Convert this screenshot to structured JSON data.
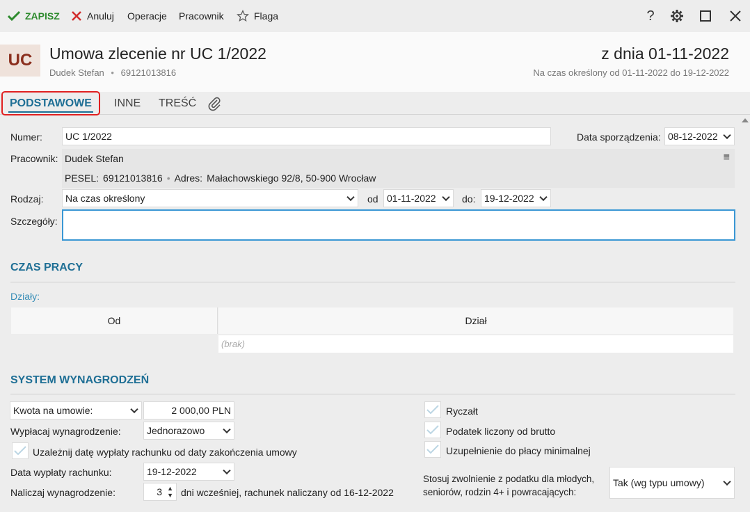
{
  "toolbar": {
    "save_label": "ZAPISZ",
    "cancel_label": "Anuluj",
    "operations_label": "Operacje",
    "employee_label": "Pracownik",
    "flag_label": "Flaga",
    "help_label": "?"
  },
  "header": {
    "badge": "UC",
    "title": "Umowa zlecenie nr UC 1/2022",
    "employee_name": "Dudek Stefan",
    "employee_id": "69121013816",
    "date_label": "z dnia 01-11-2022",
    "period_label": "Na czas określony od 01-11-2022 do 19-12-2022"
  },
  "tabs": [
    {
      "label": "PODSTAWOWE",
      "active": true
    },
    {
      "label": "INNE",
      "active": false
    },
    {
      "label": "TREŚĆ",
      "active": false
    }
  ],
  "form": {
    "number_label": "Numer:",
    "number_value": "UC 1/2022",
    "created_label": "Data sporządzenia:",
    "created_value": "08-12-2022",
    "employee_label": "Pracownik:",
    "employee_value": "Dudek Stefan",
    "pesel_label": "PESEL:",
    "pesel_value": "69121013816",
    "address_label": "Adres:",
    "address_value": "Małachowskiego 92/8, 50-900 Wrocław",
    "type_label": "Rodzaj:",
    "type_value": "Na czas określony",
    "from_label": "od",
    "from_value": "01-11-2022",
    "to_label": "do:",
    "to_value": "19-12-2022",
    "details_label": "Szczegóły:",
    "details_value": ""
  },
  "work_time": {
    "section_title": "CZAS PRACY",
    "departments_label": "Działy:",
    "columns": [
      "Od",
      "Dział"
    ],
    "empty_text": "(brak)"
  },
  "salary": {
    "section_title": "SYSTEM WYNAGRODZEŃ",
    "amount_type": "Kwota na umowie:",
    "amount_value": "2 000,00 PLN",
    "pay_label": "Wypłacaj wynagrodzenie:",
    "pay_value": "Jednorazowo",
    "depend_label": "Uzależnij datę wypłaty rachunku od daty zakończenia umowy",
    "payout_date_label": "Data wypłaty rachunku:",
    "payout_date_value": "19-12-2022",
    "accrue_label": "Naliczaj wynagrodzenie:",
    "accrue_value": "3",
    "accrue_suffix": "dni wcześniej, rachunek naliczany od 16-12-2022",
    "lump_sum_label": "Ryczałt",
    "gross_tax_label": "Podatek liczony od brutto",
    "min_wage_label": "Uzupełnienie do płacy minimalnej",
    "exemption_label_1": "Stosuj zwolnienie z podatku dla młodych,",
    "exemption_label_2": "seniorów, rodzin 4+ i powracających:",
    "exemption_value": "Tak (wg typu umowy)"
  },
  "colors": {
    "accent": "#1f6f95",
    "save_green": "#2e8b2e",
    "cancel_red": "#d22f2f",
    "badge_bg": "#efe2db",
    "badge_text": "#8b2f1e",
    "tab_highlight": "#e02020"
  },
  "icons": {
    "save": "checkmark-icon",
    "cancel": "x-icon",
    "flag": "star-icon",
    "settings": "gear-icon",
    "maximize": "square-icon",
    "close": "close-icon",
    "attachment": "paperclip-icon",
    "menu": "hamburger-icon"
  }
}
